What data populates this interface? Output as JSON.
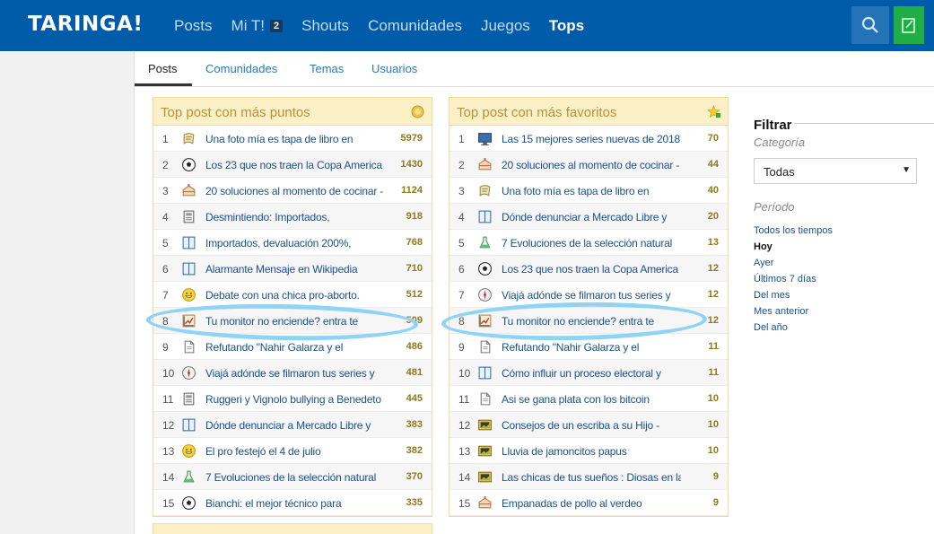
{
  "header": {
    "logo": "TARINGA!",
    "nav": [
      {
        "label": "Posts"
      },
      {
        "label": "Mi T!",
        "badge": "2"
      },
      {
        "label": "Shouts"
      },
      {
        "label": "Comunidades"
      },
      {
        "label": "Juegos"
      },
      {
        "label": "Tops"
      }
    ]
  },
  "subtabs": [
    "Posts",
    "Comunidades",
    "Temas",
    "Usuarios"
  ],
  "panel_points": {
    "title": "Top post con más puntos",
    "rows": [
      {
        "n": "1",
        "icon": "paper-icon",
        "title": "Una foto mía es tapa de libro en",
        "pts": "5979"
      },
      {
        "n": "2",
        "icon": "soccer-ball-icon",
        "title": "Los 23 que nos traen la Copa America",
        "pts": "1430"
      },
      {
        "n": "3",
        "icon": "cake-icon",
        "title": "20 soluciones al momento de cocinar -",
        "pts": "1124"
      },
      {
        "n": "4",
        "icon": "newspaper-icon",
        "title": "Desmintiendo: Importados,",
        "pts": "918"
      },
      {
        "n": "5",
        "icon": "book-icon",
        "title": "Importados, devaluación 200%,",
        "pts": "768"
      },
      {
        "n": "6",
        "icon": "book-icon",
        "title": "Alarmante Mensaje en Wikipedia",
        "pts": "710"
      },
      {
        "n": "7",
        "icon": "smiley-icon",
        "title": "Debate con una chica pro-aborto.",
        "pts": "512"
      },
      {
        "n": "8",
        "icon": "chart-icon",
        "title": "Tu monitor no enciende? entra te",
        "pts": "509"
      },
      {
        "n": "9",
        "icon": "document-icon",
        "title": "Refutando \"Nahir Galarza y el",
        "pts": "486"
      },
      {
        "n": "10",
        "icon": "compass-icon",
        "title": "Viajá adónde se filmaron tus series y",
        "pts": "481"
      },
      {
        "n": "11",
        "icon": "newspaper-icon",
        "title": "Ruggeri y Vignolo bullying a Benedeto",
        "pts": "445"
      },
      {
        "n": "12",
        "icon": "book-icon",
        "title": "Dónde denunciar a Mercado Libre y",
        "pts": "383"
      },
      {
        "n": "13",
        "icon": "smiley-icon",
        "title": "El pro festejó el 4 de julio",
        "pts": "382"
      },
      {
        "n": "14",
        "icon": "flask-icon",
        "title": "7 Evoluciones de la selección natural",
        "pts": "370"
      },
      {
        "n": "15",
        "icon": "soccer-ball-icon",
        "title": "Bianchi: el mejor técnico para",
        "pts": "335"
      }
    ]
  },
  "panel_favs": {
    "title": "Top post con más favoritos",
    "rows": [
      {
        "n": "1",
        "icon": "monitor-icon",
        "title": "Las 15 mejores series nuevas de 2018",
        "pts": "70"
      },
      {
        "n": "2",
        "icon": "cake-icon",
        "title": "20 soluciones al momento de cocinar -",
        "pts": "44"
      },
      {
        "n": "3",
        "icon": "paper-icon",
        "title": "Una foto mía es tapa de libro en",
        "pts": "40"
      },
      {
        "n": "4",
        "icon": "book-icon",
        "title": "Dónde denunciar a Mercado Libre y",
        "pts": "20"
      },
      {
        "n": "5",
        "icon": "flask-icon",
        "title": "7 Evoluciones de la selección natural",
        "pts": "13"
      },
      {
        "n": "6",
        "icon": "soccer-ball-icon",
        "title": "Los 23 que nos traen la Copa America",
        "pts": "12"
      },
      {
        "n": "7",
        "icon": "compass-icon",
        "title": "Viajá adónde se filmaron tus series y",
        "pts": "12"
      },
      {
        "n": "8",
        "icon": "chart-icon",
        "title": "Tu monitor no enciende? entra te",
        "pts": "12"
      },
      {
        "n": "9",
        "icon": "document-icon",
        "title": "Refutando \"Nahir Galarza y el",
        "pts": "11"
      },
      {
        "n": "10",
        "icon": "book-icon",
        "title": "Cómo influir un proceso electoral y",
        "pts": "11"
      },
      {
        "n": "11",
        "icon": "document-icon",
        "title": "Asi se gana plata con los bitcoin",
        "pts": "10"
      },
      {
        "n": "12",
        "icon": "picture-icon",
        "title": "Consejos de un escriba a su Hijo -",
        "pts": "10"
      },
      {
        "n": "13",
        "icon": "picture-icon",
        "title": "Lluvia de jamoncitos papus",
        "pts": "10"
      },
      {
        "n": "14",
        "icon": "picture-icon",
        "title": "Las chicas de tus sueños : Diosas en la",
        "pts": "9"
      },
      {
        "n": "15",
        "icon": "cake-icon",
        "title": "Empanadas de pollo al verdeo",
        "pts": "9"
      }
    ]
  },
  "filter": {
    "title": "Filtrar",
    "category_label": "Categoría",
    "category_value": "Todas",
    "period_label": "Período",
    "periods": [
      "Todos los tiempos",
      "Hoy",
      "Ayer",
      "Últimos 7 días",
      "Del mes",
      "Mes anterior",
      "Del año"
    ],
    "active_period": "Hoy"
  },
  "colors": {
    "header_bg": "#005ca8",
    "panel_head": "#fbf0c6",
    "panel_title": "#b8913a",
    "link": "#1b4f8c",
    "points": "#8a7b1e",
    "highlight": "#8fd3f5",
    "write_button": "#1fae45"
  }
}
